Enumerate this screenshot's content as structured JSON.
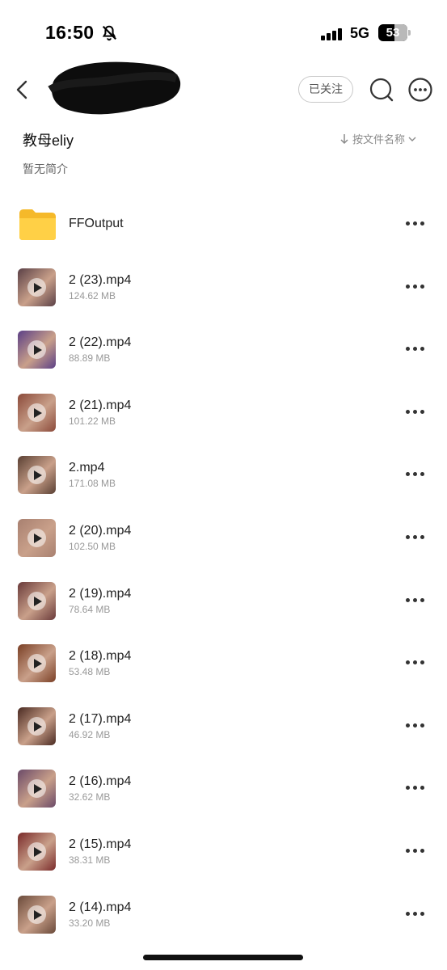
{
  "status_bar": {
    "time": "16:50",
    "network": "5G",
    "battery": "53"
  },
  "header": {
    "follow_label": "已关注"
  },
  "folder": {
    "title": "教母eliy",
    "intro": "暂无简介",
    "sort_label": "按文件名称"
  },
  "files": [
    {
      "type": "folder",
      "name": "FFOutput",
      "size": ""
    },
    {
      "type": "video",
      "name": "2 (23).mp4",
      "size": "124.62 MB",
      "thumb_color": "#5a4046"
    },
    {
      "type": "video",
      "name": "2 (22).mp4",
      "size": "88.89 MB",
      "thumb_color": "#5b3f86"
    },
    {
      "type": "video",
      "name": "2 (21).mp4",
      "size": "101.22 MB",
      "thumb_color": "#8b4a3a"
    },
    {
      "type": "video",
      "name": "2.mp4",
      "size": "171.08 MB",
      "thumb_color": "#5a4033"
    },
    {
      "type": "video",
      "name": "2 (20).mp4",
      "size": "102.50 MB",
      "thumb_color": "#a88070"
    },
    {
      "type": "video",
      "name": "2 (19).mp4",
      "size": "78.64 MB",
      "thumb_color": "#6a3a3a"
    },
    {
      "type": "video",
      "name": "2 (18).mp4",
      "size": "53.48 MB",
      "thumb_color": "#7a3f25"
    },
    {
      "type": "video",
      "name": "2 (17).mp4",
      "size": "46.92 MB",
      "thumb_color": "#4a2a22"
    },
    {
      "type": "video",
      "name": "2 (16).mp4",
      "size": "32.62 MB",
      "thumb_color": "#6b4a68"
    },
    {
      "type": "video",
      "name": "2 (15).mp4",
      "size": "38.31 MB",
      "thumb_color": "#7a2a2a"
    },
    {
      "type": "video",
      "name": "2 (14).mp4",
      "size": "33.20 MB",
      "thumb_color": "#6a4a3a"
    }
  ]
}
